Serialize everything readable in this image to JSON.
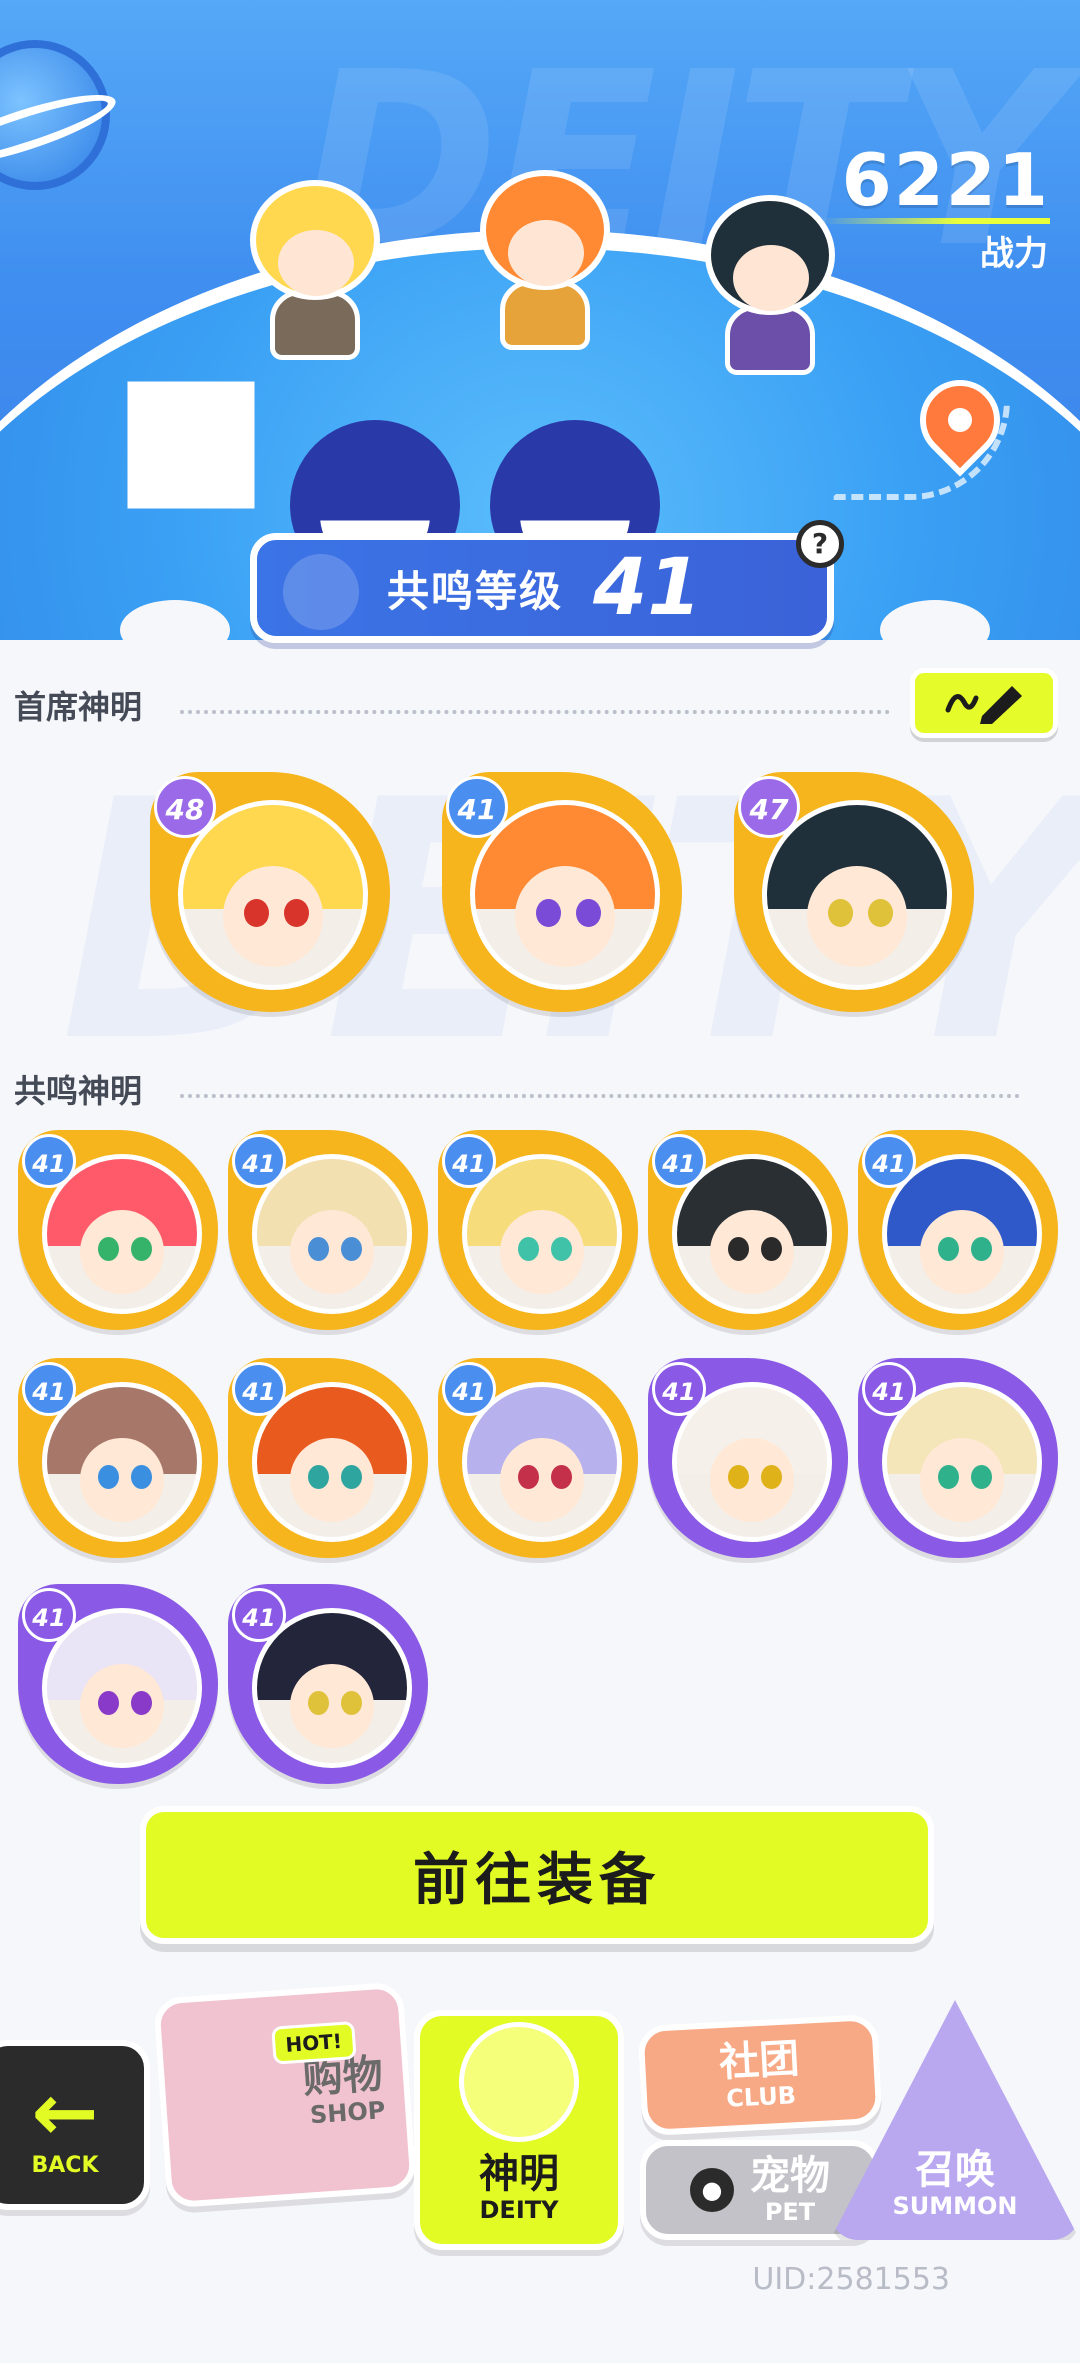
{
  "header": {
    "watermark": "DEITY",
    "power": {
      "value": "6221",
      "label": "战力"
    },
    "resonance": {
      "label": "共鸣等级",
      "level": "41"
    },
    "help_label": "?",
    "colors": {
      "sky": "#3f8ef0",
      "accent": "#e3fb24",
      "pin": "#ff7a3c"
    },
    "header_characters": [
      {
        "name": "chibi-blonde"
      },
      {
        "name": "chibi-orange-hat"
      },
      {
        "name": "chibi-dark-hair"
      }
    ]
  },
  "chief": {
    "title": "首席神明",
    "edit_icon": "pencil-icon",
    "deities": [
      {
        "level": "48",
        "frame": "gold",
        "hair": "#ffd84f",
        "eye": "#d9342b"
      },
      {
        "level": "41",
        "frame": "gold",
        "hair": "#ff8a33",
        "eye": "#7a4bd6"
      },
      {
        "level": "47",
        "frame": "gold",
        "hair": "#20303a",
        "eye": "#e0c23a"
      }
    ]
  },
  "resonance_section": {
    "title": "共鸣神明",
    "deities": [
      {
        "level": "41",
        "frame": "gold",
        "hair": "#ff5a6a",
        "eye": "#36b36b"
      },
      {
        "level": "41",
        "frame": "gold",
        "hair": "#f3e0b0",
        "eye": "#4a8fd6"
      },
      {
        "level": "41",
        "frame": "gold",
        "hair": "#f6dc7a",
        "eye": "#3fc2a8"
      },
      {
        "level": "41",
        "frame": "gold",
        "hair": "#2a2f33",
        "eye": "#2a2a2a"
      },
      {
        "level": "41",
        "frame": "gold",
        "hair": "#2f59c8",
        "eye": "#2fb18c"
      },
      {
        "level": "41",
        "frame": "gold",
        "hair": "#a7786a",
        "eye": "#3a8fe0"
      },
      {
        "level": "41",
        "frame": "gold",
        "hair": "#e85a1e",
        "eye": "#2fa5a0"
      },
      {
        "level": "41",
        "frame": "gold",
        "hair": "#b7b2ee",
        "eye": "#c4304a"
      },
      {
        "level": "41",
        "frame": "purple",
        "hair": "#f6f0ea",
        "eye": "#e0b21a"
      },
      {
        "level": "41",
        "frame": "purple",
        "hair": "#f4e6b8",
        "eye": "#2fb18c"
      },
      {
        "level": "41",
        "frame": "purple",
        "hair": "#e9e4f6",
        "eye": "#8a3ac8"
      },
      {
        "level": "41",
        "frame": "purple",
        "hair": "#23263a",
        "eye": "#e0c23a"
      }
    ]
  },
  "equip_button": "前往装备",
  "bottom_nav": {
    "back": {
      "en": "BACK",
      "icon": "arrow-left-icon"
    },
    "shop": {
      "zh": "购物",
      "en": "SHOP",
      "badge": "HOT!"
    },
    "deity": {
      "zh": "神明",
      "en": "DEITY"
    },
    "club": {
      "zh": "社团",
      "en": "CLUB"
    },
    "pet": {
      "zh": "宠物",
      "en": "PET",
      "icon": "lock-icon"
    },
    "summon": {
      "zh": "召唤",
      "en": "SUMMON"
    }
  },
  "uid": "UID:2581553"
}
